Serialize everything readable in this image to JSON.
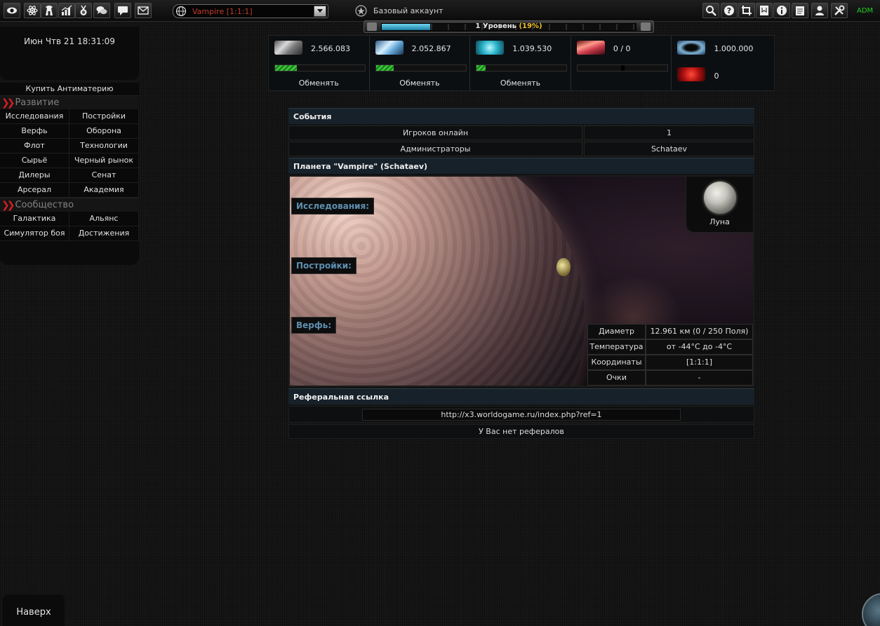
{
  "topbar": {
    "icons": [
      "eye-icon",
      "atom-icon",
      "tower-icon",
      "statistics-icon",
      "medal-icon",
      "chat-icon",
      "message-icon",
      "mail-icon"
    ],
    "planet_selector": "Vampire [1:1:1]",
    "account_type": "Базовый аккаунт",
    "right_icons": [
      "search-icon",
      "help-icon",
      "crop-icon",
      "notes-icon",
      "notepad-icon",
      "info-icon",
      "document-icon",
      "buddies-icon",
      "settings-icon"
    ],
    "adm_label": "ADM"
  },
  "level": {
    "label": "1 Уровень",
    "percent_text": "(19%)",
    "progress": 0.19
  },
  "sidebar": {
    "datetime": "Июн Чтв 21 18:31:09",
    "buy_antimatter": "Купить Антиматерию",
    "section_development": "Развитие",
    "development_items": [
      "Исследования",
      "Постройки",
      "Верфь",
      "Оборона",
      "Флот",
      "Технологии",
      "Сырьё",
      "Черный рынок",
      "Дилеры",
      "Сенат",
      "Арсерал",
      "Академия"
    ],
    "section_community": "Сообщество",
    "community_items": [
      "Галактика",
      "Альянс",
      "Симулятор боя",
      "Достижения"
    ]
  },
  "resources": {
    "metal": {
      "value": "2.566.083",
      "fill": 0.24,
      "action": "Обменять"
    },
    "crystal": {
      "value": "2.052.867",
      "fill": 0.2,
      "action": "Обменять"
    },
    "deuterium": {
      "value": "1.039.530",
      "fill": 0.1,
      "action": "Обменять"
    },
    "energy": {
      "value": "0 / 0"
    },
    "darkmatter": {
      "value": "1.000.000"
    },
    "antimatter": {
      "value": "0"
    }
  },
  "events": {
    "title": "События",
    "rows": [
      {
        "label": "Игроков онлайн",
        "value": "1"
      },
      {
        "label": "Администраторы",
        "value": "Schataev"
      }
    ]
  },
  "planet": {
    "title": "Планета \"Vampire\" (Schataev)",
    "labels": {
      "research": "Исследования:",
      "buildings": "Постройки:",
      "shipyard": "Верфь:"
    },
    "moon_label": "Луна",
    "info": [
      {
        "key": "Диаметр",
        "value": "12.961 км (0 / 250 Поля)"
      },
      {
        "key": "Температура",
        "value": "от -44°C до -4°C"
      },
      {
        "key": "Координаты",
        "value": "[1:1:1]"
      },
      {
        "key": "Очки",
        "value": "-"
      }
    ]
  },
  "referral": {
    "title": "Реферальная ссылка",
    "link": "http://x3.worldogame.ru/index.php?ref=1",
    "none_text": "У Вас нет рефералов"
  },
  "footer": {
    "to_top": "Наверх"
  },
  "colors": {
    "accent_red": "#c33a2a",
    "adm_green": "#1fd21f",
    "level_pct": "#f0c020",
    "label_blue": "#5e8fb0"
  }
}
